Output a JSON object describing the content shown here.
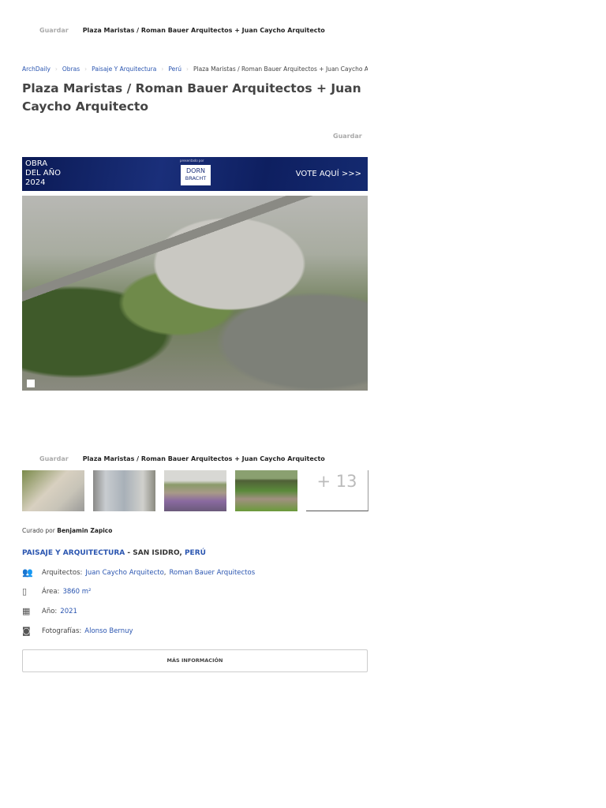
{
  "sticky_bar": {
    "save": "Guardar",
    "title": "Plaza Maristas / Roman Bauer Arquitectos + Juan Caycho Arquitecto"
  },
  "breadcrumb": [
    "ArchDaily",
    "Obras",
    "Paisaje Y Arquitectura",
    "Perú",
    "Plaza Maristas / Roman Bauer Arquitectos + Juan Caycho Arquitecto"
  ],
  "page_title": "Plaza Maristas / Roman Bauer Arquitectos + Juan Caycho Arquitecto",
  "save_label": "Guardar",
  "banner": {
    "line1": "OBRA",
    "line2": "DEL AÑO",
    "line3": "2024",
    "presented": "presentado por",
    "logo1": "DORN",
    "logo2": "BRACHT",
    "vote": "VOTE AQUÍ >>>"
  },
  "gallery": {
    "more": "+ 13"
  },
  "curated": {
    "prefix": "Curado por",
    "name": "Benjamin Zapico"
  },
  "category": {
    "type": "PAISAJE Y ARQUITECTURA",
    "sep": " - SAN ISIDRO, ",
    "country": "PERÚ"
  },
  "specs": {
    "architects_label": "Arquitectos:",
    "architect1": "Juan Caycho Arquitecto",
    "comma": ",",
    "architect2": "Roman Bauer Arquitectos",
    "area_label": "Área:",
    "area_value": "3860 m²",
    "year_label": "Año:",
    "year_value": "2021",
    "photos_label": "Fotografías:",
    "photographer": "Alonso Bernuy"
  },
  "more_info": "MÁS INFORMACIÓN"
}
